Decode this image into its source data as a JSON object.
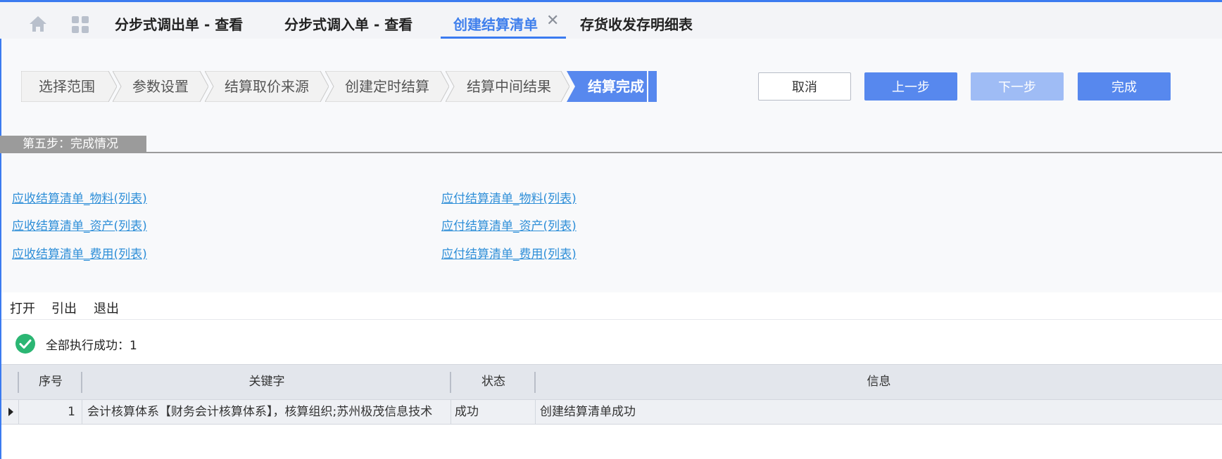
{
  "tabs": [
    {
      "label": "分步式调出单 - 查看",
      "active": false
    },
    {
      "label": "分步式调入单 - 查看",
      "active": false
    },
    {
      "label": "创建结算清单",
      "active": true
    },
    {
      "label": "存货收发存明细表",
      "active": false
    }
  ],
  "tab_close_glyph": "✕",
  "steps": [
    {
      "label": "选择范围",
      "active": false
    },
    {
      "label": "参数设置",
      "active": false
    },
    {
      "label": "结算取价来源",
      "active": false
    },
    {
      "label": "创建定时结算",
      "active": false
    },
    {
      "label": "结算中间结果",
      "active": false
    },
    {
      "label": "结算完成",
      "active": true
    }
  ],
  "actions": {
    "cancel": "取消",
    "prev": "上一步",
    "next": "下一步",
    "finish": "完成"
  },
  "section_title": "第五步：完成情况",
  "links": {
    "receivable": [
      "应收结算清单_物料(列表)",
      "应收结算清单_资产(列表)",
      "应收结算清单_费用(列表)"
    ],
    "payable": [
      "应付结算清单_物料(列表)",
      "应付结算清单_资产(列表)",
      "应付结算清单_费用(列表)"
    ]
  },
  "toolbar": {
    "open": "打开",
    "export": "引出",
    "exit": "退出"
  },
  "status_message": "全部执行成功：1",
  "table": {
    "headers": {
      "seq": "序号",
      "key": "关键字",
      "status": "状态",
      "info": "信息"
    },
    "rows": [
      {
        "seq": "1",
        "key": "会计核算体系【财务会计核算体系】，核算组织;苏州极茂信息技术",
        "status": "成功",
        "info": "创建结算清单成功"
      }
    ]
  },
  "colors": {
    "accent": "#3b7bf0",
    "active_step": "#5788ee",
    "success": "#2bb673",
    "link": "#2f8fd8"
  },
  "icons": {
    "home": "home-icon",
    "apps": "apps-grid-icon",
    "success": "check-circle-icon"
  }
}
